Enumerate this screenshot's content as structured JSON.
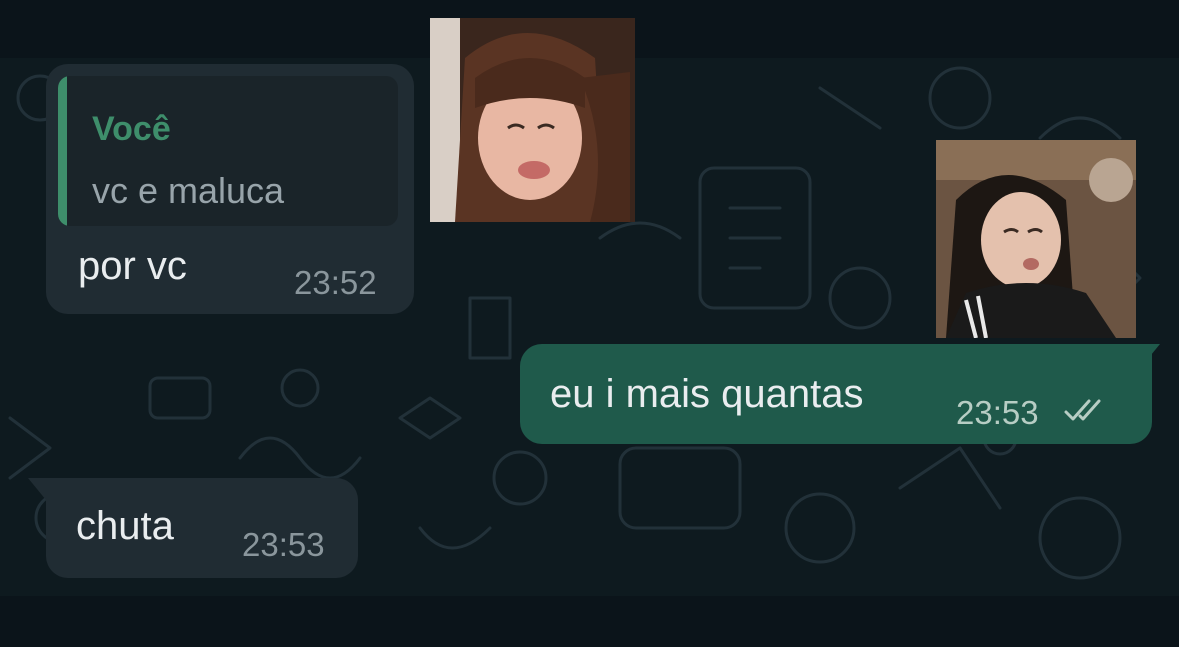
{
  "chat": {
    "messages": [
      {
        "direction": "incoming",
        "reply_to": {
          "author": "Você",
          "text": "vc e maluca"
        },
        "text": "por vc",
        "time": "23:52"
      },
      {
        "direction": "outgoing",
        "text": "eu i mais quantas",
        "time": "23:53",
        "status_icon": "double-check-icon"
      },
      {
        "direction": "incoming",
        "text": "chuta",
        "time": "23:53"
      }
    ],
    "stickers": [
      {
        "icon": "photo-sticker"
      },
      {
        "icon": "photo-sticker"
      }
    ]
  },
  "colors": {
    "background": "#0b141a",
    "incoming_bubble": "#202c33",
    "outgoing_bubble": "#1f5a4b",
    "quote_accent": "#3e8e6b"
  }
}
